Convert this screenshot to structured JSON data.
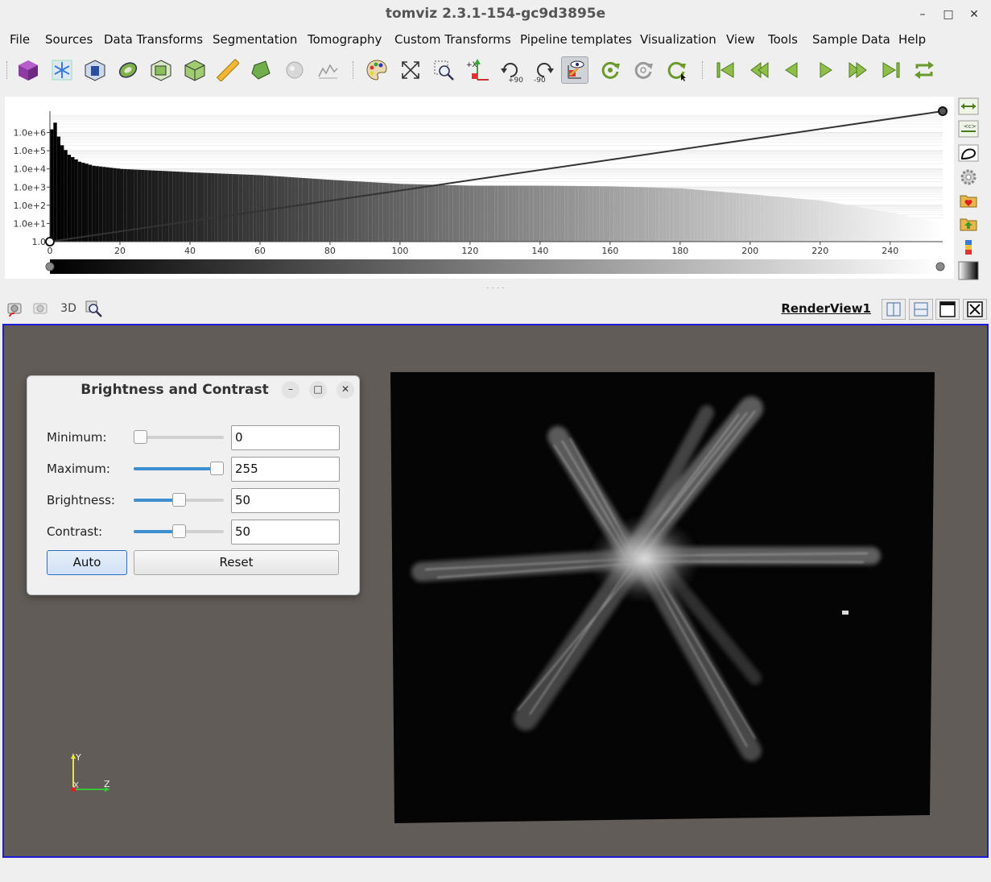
{
  "window": {
    "title": "tomviz 2.3.1-154-gc9d3895e",
    "controls": {
      "minimize": "–",
      "maximize": "□",
      "close": "✕"
    }
  },
  "menu": [
    "File",
    "Sources",
    "Data Transforms",
    "Segmentation",
    "Tomography",
    "Custom Transforms",
    "Pipeline templates",
    "Visualization",
    "View",
    "Tools",
    "Sample Data",
    "Help"
  ],
  "toolbar": {
    "icons": [
      "cube-icon",
      "snowflake-icon",
      "box-outline-icon",
      "ring-icon",
      "clip-box-icon",
      "cube-outline-icon",
      "ruler-icon",
      "shape-icon",
      "sphere-icon",
      "histogram-line-icon",
      "palette-icon",
      "fit-view-icon",
      "zoom-selection-icon",
      "axes-icon",
      "rotate-plus90-icon",
      "rotate-minus90-icon",
      "eye-pick-icon",
      "refresh-icon",
      "refresh-outline-icon",
      "refresh-cursor-icon",
      "first-frame-icon",
      "prev-frame-icon",
      "play-back-icon",
      "play-icon",
      "next-frame-icon",
      "last-frame-icon",
      "loop-icon"
    ],
    "rotate_plus_label": "+90",
    "rotate_minus_label": "-90",
    "axes_label": "+X"
  },
  "chart_data": {
    "type": "bar",
    "title": "",
    "xlabel": "",
    "ylabel": "",
    "y_scale": "log",
    "x_ticks": [
      "0",
      "20",
      "40",
      "60",
      "80",
      "100",
      "120",
      "140",
      "160",
      "180",
      "200",
      "220",
      "240"
    ],
    "y_ticks": [
      "1.0",
      "1.0e+1",
      "1.0e+2",
      "1.0e+3",
      "1.0e+4",
      "1.0e+5",
      "1.0e+6"
    ],
    "xlim": [
      0,
      255
    ],
    "ylim": [
      1,
      10000000
    ],
    "bin_samples": [
      {
        "x": 0,
        "count": 1500000
      },
      {
        "x": 1,
        "count": 3500000
      },
      {
        "x": 2,
        "count": 600000
      },
      {
        "x": 3,
        "count": 200000
      },
      {
        "x": 5,
        "count": 60000
      },
      {
        "x": 8,
        "count": 25000
      },
      {
        "x": 12,
        "count": 15000
      },
      {
        "x": 20,
        "count": 10000
      },
      {
        "x": 40,
        "count": 6500
      },
      {
        "x": 60,
        "count": 4500
      },
      {
        "x": 80,
        "count": 2500
      },
      {
        "x": 100,
        "count": 1500
      },
      {
        "x": 120,
        "count": 1200
      },
      {
        "x": 140,
        "count": 1200
      },
      {
        "x": 160,
        "count": 1100
      },
      {
        "x": 180,
        "count": 850
      },
      {
        "x": 200,
        "count": 400
      },
      {
        "x": 220,
        "count": 180
      },
      {
        "x": 240,
        "count": 40
      },
      {
        "x": 255,
        "count": 10
      }
    ],
    "opacity_line": [
      {
        "x": 0,
        "y": 0
      },
      {
        "x": 255,
        "y": 1
      }
    ],
    "colormap": "grayscale"
  },
  "histogram_side_buttons": [
    "reset-range-icon",
    "custom-range-icon",
    "toggle-legend-icon",
    "settings-gear-icon",
    "save-preset-icon",
    "import-preset-icon",
    "color-legend-icon",
    "gradient-opacity-icon"
  ],
  "viewbar": {
    "label_3d": "3D",
    "view_name": "RenderView1",
    "icons": [
      "camera-undo-icon",
      "camera-redo-icon",
      "zoom-data-icon"
    ]
  },
  "dialog": {
    "title": "Brightness and Contrast",
    "rows": [
      {
        "label": "Minimum:",
        "value": "0",
        "level": 0.0
      },
      {
        "label": "Maximum:",
        "value": "255",
        "level": 1.0
      },
      {
        "label": "Brightness:",
        "value": "50",
        "level": 0.5
      },
      {
        "label": "Contrast:",
        "value": "50",
        "level": 0.5
      }
    ],
    "auto_label": "Auto",
    "reset_label": "Reset"
  },
  "axes": {
    "y": "Y",
    "x": "X",
    "z": "Z"
  },
  "colors": {
    "render_bg": "#625c59",
    "view_border": "#1c1cd6",
    "slider_fill": "#3d8fd0"
  }
}
